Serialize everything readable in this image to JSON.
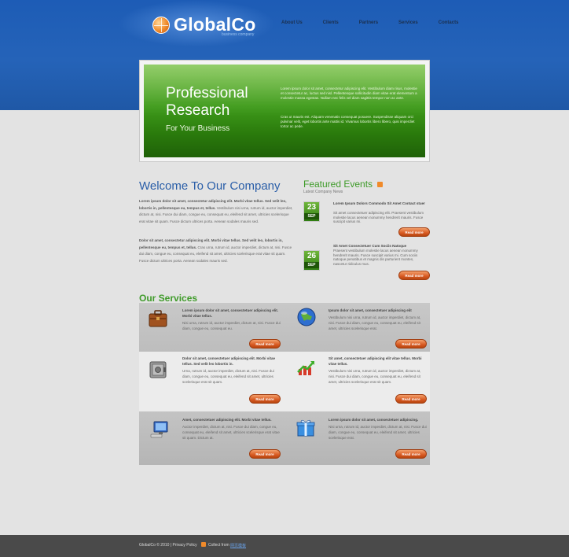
{
  "brand": {
    "name": "GlobalCo",
    "tagline": "business company"
  },
  "nav": [
    "About Us",
    "Clients",
    "Partners",
    "Services",
    "Contacts"
  ],
  "banner": {
    "title": "Professional Research",
    "subtitle": "For Your Business",
    "text1": "Lorem ipsum dolor sit amet, consectetur adipiscing elit. Vestibulum diam risus, molestie et consectetur ac, luctus sed nisl. Pellentesque sollicitudin diam vitae erat elementum a molestie massa egestas. Nullam nec felis vel diam sagittis tempor non ac ante.",
    "text2": "Cras ut mauris est. Aliquam venenatis consequat posuere. Suspendisse aliquam orci pulvinar velit, eget lobortis ante mattis id. Vivamus lobortis libero libero, quis imperdiet tortor ac pede."
  },
  "welcome": {
    "title": "Welcome To Our Company",
    "para1_bold": "Lorem ipsum dolor sit amet, consectetur adipiscing elit. Morbi vitae tellus. Sed velit leo, lobortis in, pellentesque eu, tempus et, tellus.",
    "para1": "Vestibulum nisi urna, rutrum id, auctor imperdiet, dictum at, nisi. Fusce dui diam, congue eu, consequat eu, eleifend sit amet, ultricies scelerisque erat vitae sit quam. Fusce dictum ultrices porta. Aenean sodales mauris sed.",
    "para2_bold": "Dolor sit amet, consectetur adipiscing elit. Morbi vitae tellus. Sed velit leo, lobortis in, pellentesque eu, tempus et, tellus.",
    "para2": "Cras urna, rutrum id, auctor imperdiet, dictum at, nisi. Fusce dui diam, congue eu, consequat eu, eleifend sit amet, ultricies scelerisque erat vitae sit quam. Fusce dictum ultrices porta. Aenean sodales mauris sed."
  },
  "events": {
    "title": "Featured Events",
    "subtitle": "Latest Company News",
    "items": [
      {
        "day": "23",
        "month": "SEP",
        "title": "Lorem Ipsum Dolors Commodo Sit Amet Contact stuer",
        "text": "Sit amet consectetuer adipiscing elit. Praesent vestibulum molestie lacus aenean nonummy hendrerit mauris. Fusce suscipit varius mi.",
        "button": "Read more"
      },
      {
        "day": "26",
        "month": "SEP",
        "title": "Sit Amet Consectetuer Cum Sociis Natoque",
        "text": "Praesent vestibulum molestie lacus aenean nonummy hendrerit mauris. Fusce suscipit varius mi. Cum sociis natoque penatibus et magnis dis parturient montes, nascetur ridiculus mus.",
        "button": "Read more"
      }
    ]
  },
  "services": {
    "title": "Our Services",
    "items": [
      {
        "icon": "briefcase-icon",
        "head": "Lorem ipsum dolor sit amet, consectetuer adipiscing elit. Morbi vitae tellus.",
        "text": "Nisi urna, rutrum id, auctor imperdiet, dictum at, nisi. Fusce dui diam, congue eu, consequat eu.",
        "button": "Read more"
      },
      {
        "icon": "globe-icon",
        "head": "Ipsum dolor sit amet, consectetuer adipiscing elit",
        "text": "Vestibulum nisi urna, rutrum id, auctor imperdiet, dictum at, nisi. Fusce dui diam, congue eu, consequat eu, eleifend sit amet, ultricies scelerisque erat.",
        "button": "Read more"
      },
      {
        "icon": "safe-icon",
        "head": "Dolor sit amet, consectetuer adipiscing elit. Morbi vitae tellus. Sed velit leo lobortis in.",
        "text": "Urna, rutrum id, auctor imperdiet, dictum at, nisi. Fusce dui diam, congue eu, consequat eu, eleifend sit amet, ultricies scelerisque erat sit quam.",
        "button": "Read more"
      },
      {
        "icon": "chart-arrow-icon",
        "head": "Sit amet, consectetuer adipiscing elit vitae tellus. Morbi vitae tellus.",
        "text": "Vestibulum nisi urna, rutrum id, auctor imperdiet, dictum at, nisi. Fusce dui diam, congue eu, consequat eu, eleifend sit amet, ultricies scelerisque erat sit quam.",
        "button": "Read more"
      },
      {
        "icon": "computer-icon",
        "head": "Amet, consectetuer adipiscing elit. Morbi vitae tellus.",
        "text": "Auctor imperdiet, dictum at, nisi. Fusce dui diam, congue eu, consequat eu, eleifend sit amet, ultricies scelerisque erat vitae sit quam. Dictum at.",
        "button": "Read more"
      },
      {
        "icon": "gift-icon",
        "head": "Lorem ipsum dolor sit amet, consectetuer adipiscing.",
        "text": "Nisi urna, rutrum id, auctor imperdiet, dictum at, nisi. Fusce dui diam, congue eu, consequat eu, eleifend sit amet, ultricies scelerisque erat.",
        "button": "Read more"
      }
    ]
  },
  "footer": {
    "copyright": "GlobalCo © 2010 | Privacy Policy",
    "collect": "Collect from",
    "link": "网页模板"
  },
  "colors": {
    "header_blue": "#1d5cb6",
    "banner_green": "#3f9b1b",
    "title_blue": "#2a5ea8",
    "heading_green": "#3f9b2a",
    "button_orange": "#d85a22",
    "footer_gray": "#4a4a4a"
  }
}
